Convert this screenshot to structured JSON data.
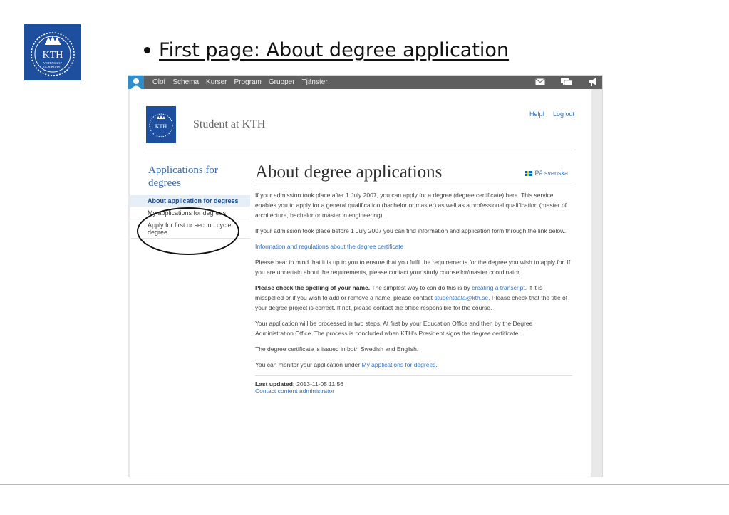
{
  "slide": {
    "title": "First page: About degree application",
    "logo_text": "KTH",
    "logo_subtext": "VETENSKAP OCH KONST"
  },
  "topbar": {
    "nav": [
      "Olof",
      "Schema",
      "Kurser",
      "Program",
      "Grupper",
      "Tjänster"
    ],
    "icons": [
      "user-icon",
      "mail-icon",
      "chat-icon",
      "megaphone-icon"
    ]
  },
  "header": {
    "site_title": "Student at KTH",
    "help_label": "Help!",
    "logout_label": "Log out"
  },
  "sidebar": {
    "title": "Applications for degrees",
    "items": [
      {
        "label": "About application for degrees",
        "active": true
      },
      {
        "label": "My applications for degrees",
        "active": false
      },
      {
        "label": "Apply for first or second cycle degree",
        "active": false
      }
    ]
  },
  "main": {
    "title": "About degree applications",
    "lang_link": "På svenska",
    "p1": "If your admission took place after 1 July 2007, you can apply for a degree (degree certificate) here. This service enables you to apply for a general qualification (bachelor or master) as well as a professional qualification (master of architecture, bachelor or master in engineering).",
    "p2": "If your admission took place before 1 July 2007 you can find information and application form through the link below.",
    "p3_link": "Information and regulations about the degree certificate",
    "p4": "Please bear in mind that it is up to you to ensure that you fulfil the requirements for the degree you wish to apply for. If you are uncertain about the requirements, please contact your study counsellor/master coordinator.",
    "p5_bold": "Please check the spelling of your name.",
    "p5_a": " The simplest way to can do this is by ",
    "p5_link1": "creating a transcript",
    "p5_b": ". If it is misspelled or if you wish to add or remove a name, please contact ",
    "p5_link2": "studentdata@kth.se",
    "p5_c": ". Please check that the title of your degree project is correct. If not, please contact the office responsible for the course.",
    "p6": "Your application will be processed in two steps. At first by your Education Office and then by the Degree Administration Office. The process is concluded when KTH's President signs the degree certificate.",
    "p7": "The degree certificate is issued in both Swedish and English.",
    "p8_a": "You can monitor your application under ",
    "p8_link": "My applications for degrees",
    "p8_b": ".",
    "last_updated_label": "Last updated:",
    "last_updated_value": " 2013-11-05 11:56",
    "contact_link": "Contact content administrator"
  },
  "colors": {
    "kth_blue": "#1d4f9e",
    "link_blue": "#3772b8",
    "topbar_gray": "#5f5f5f"
  }
}
